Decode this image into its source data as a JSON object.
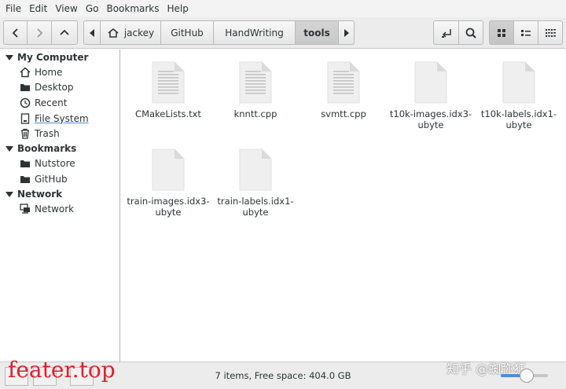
{
  "menu": [
    "File",
    "Edit",
    "View",
    "Go",
    "Bookmarks",
    "Help"
  ],
  "path": [
    "jackey",
    "GitHub",
    "HandWriting",
    "tools"
  ],
  "sidebar": {
    "sections": [
      {
        "title": "My Computer",
        "items": [
          {
            "label": "Home",
            "icon": "home-icon"
          },
          {
            "label": "Desktop",
            "icon": "folder-icon"
          },
          {
            "label": "Recent",
            "icon": "clock-icon"
          },
          {
            "label": "File System",
            "icon": "drive-icon"
          },
          {
            "label": "Trash",
            "icon": "trash-icon"
          }
        ]
      },
      {
        "title": "Bookmarks",
        "items": [
          {
            "label": "Nutstore",
            "icon": "folder-icon"
          },
          {
            "label": "GitHub",
            "icon": "folder-icon"
          }
        ]
      },
      {
        "title": "Network",
        "items": [
          {
            "label": "Network",
            "icon": "network-icon"
          }
        ]
      }
    ]
  },
  "files": [
    {
      "line1": "CMakeLists.txt",
      "line2": "",
      "type": "text"
    },
    {
      "line1": "knntt.cpp",
      "line2": "",
      "type": "text"
    },
    {
      "line1": "svmtt.cpp",
      "line2": "",
      "type": "text"
    },
    {
      "line1": "t10k-images.idx3-",
      "line2": "ubyte",
      "type": "binary"
    },
    {
      "line1": "t10k-labels.idx1-",
      "line2": "ubyte",
      "type": "binary"
    },
    {
      "line1": "train-images.idx3-",
      "line2": "ubyte",
      "type": "binary"
    },
    {
      "line1": "train-labels.idx1-",
      "line2": "ubyte",
      "type": "binary"
    }
  ],
  "status": {
    "text": "7 items, Free space: 404.0 GB",
    "zoom_fraction": 0.55
  },
  "watermark": "feater.top",
  "zhihu_watermark": "知乎 @蜘弥狂",
  "colors": {
    "accent": "#4a90d9",
    "watermark": "#e0202a"
  }
}
